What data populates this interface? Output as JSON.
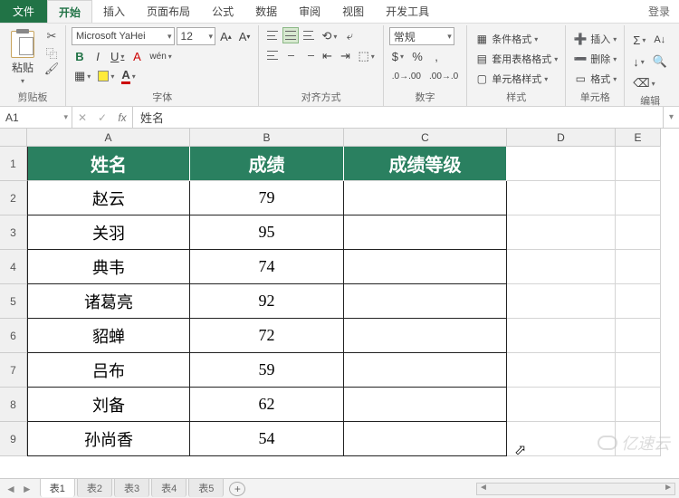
{
  "titlebar": {
    "file": "文件",
    "tabs": [
      "开始",
      "插入",
      "页面布局",
      "公式",
      "数据",
      "审阅",
      "视图",
      "开发工具"
    ],
    "active_tab": 0,
    "login": "登录"
  },
  "ribbon": {
    "clipboard": {
      "paste": "粘贴",
      "label": "剪贴板"
    },
    "font": {
      "name": "Microsoft YaHei",
      "size": "12",
      "label": "字体"
    },
    "alignment": {
      "label": "对齐方式"
    },
    "number": {
      "format": "常规",
      "label": "数字"
    },
    "styles": {
      "cond": "条件格式",
      "table": "套用表格格式",
      "cell": "单元格样式",
      "label": "样式"
    },
    "cells": {
      "insert": "插入",
      "delete": "删除",
      "format": "格式",
      "label": "单元格"
    },
    "editing": {
      "label": "编辑"
    }
  },
  "formula_bar": {
    "name_box": "A1",
    "value": "姓名"
  },
  "grid": {
    "col_widths": {
      "A": 180,
      "B": 170,
      "C": 180,
      "D": 120,
      "E": 50
    },
    "row_header_h": 38,
    "row_data_h": 38,
    "columns": [
      "A",
      "B",
      "C",
      "D",
      "E"
    ],
    "rows": [
      "1",
      "2",
      "3",
      "4",
      "5",
      "6",
      "7",
      "8",
      "9"
    ],
    "headers": [
      "姓名",
      "成绩",
      "成绩等级"
    ],
    "data": [
      {
        "name": "赵云",
        "score": "79",
        "grade": ""
      },
      {
        "name": "关羽",
        "score": "95",
        "grade": ""
      },
      {
        "name": "典韦",
        "score": "74",
        "grade": ""
      },
      {
        "name": "诸葛亮",
        "score": "92",
        "grade": ""
      },
      {
        "name": "貂蝉",
        "score": "72",
        "grade": ""
      },
      {
        "name": "吕布",
        "score": "59",
        "grade": ""
      },
      {
        "name": "刘备",
        "score": "62",
        "grade": ""
      },
      {
        "name": "孙尚香",
        "score": "54",
        "grade": ""
      }
    ]
  },
  "sheets": {
    "tabs": [
      "表1",
      "表2",
      "表3",
      "表4",
      "表5"
    ],
    "active": 0
  },
  "watermark": "亿速云"
}
